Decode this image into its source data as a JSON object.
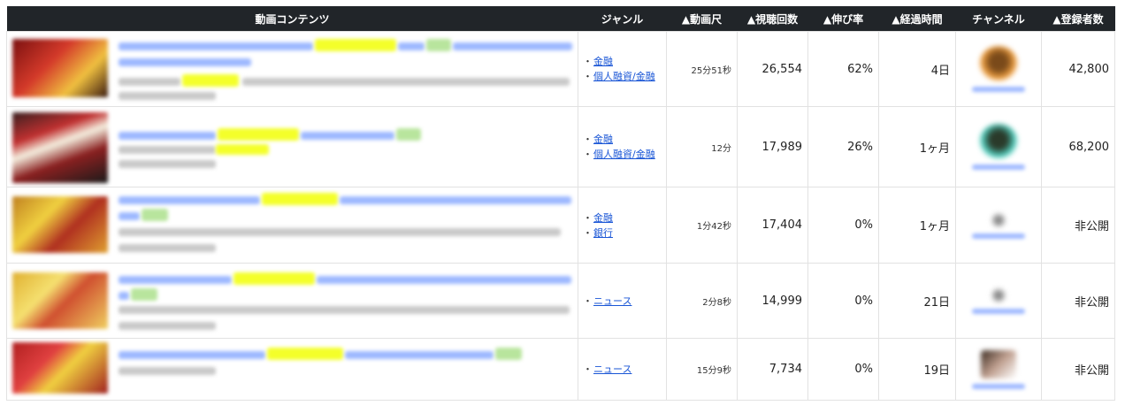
{
  "headers": {
    "content": "動画コンテンツ",
    "genre": "ジャンル",
    "duration": "▲動画尺",
    "views": "▲視聴回数",
    "growth": "▲伸び率",
    "elapsed": "▲経過時間",
    "channel": "チャンネル",
    "subscribers": "▲登録者数"
  },
  "rows": [
    {
      "genres": [
        "金融",
        "個人融資/金融"
      ],
      "duration": "25分51秒",
      "views": "26,554",
      "growth": "62%",
      "elapsed": "4日",
      "subscribers": "42,800"
    },
    {
      "genres": [
        "金融",
        "個人融資/金融"
      ],
      "duration": "12分",
      "views": "17,989",
      "growth": "26%",
      "elapsed": "1ヶ月",
      "subscribers": "68,200"
    },
    {
      "genres": [
        "金融",
        "銀行"
      ],
      "duration": "1分42秒",
      "views": "17,404",
      "growth": "0%",
      "elapsed": "1ヶ月",
      "subscribers": "非公開"
    },
    {
      "genres": [
        "ニュース"
      ],
      "duration": "2分8秒",
      "views": "14,999",
      "growth": "0%",
      "elapsed": "21日",
      "subscribers": "非公開"
    },
    {
      "genres": [
        "ニュース"
      ],
      "duration": "15分9秒",
      "views": "7,734",
      "growth": "0%",
      "elapsed": "19日",
      "subscribers": "非公開"
    }
  ],
  "genre_bullet": "・"
}
